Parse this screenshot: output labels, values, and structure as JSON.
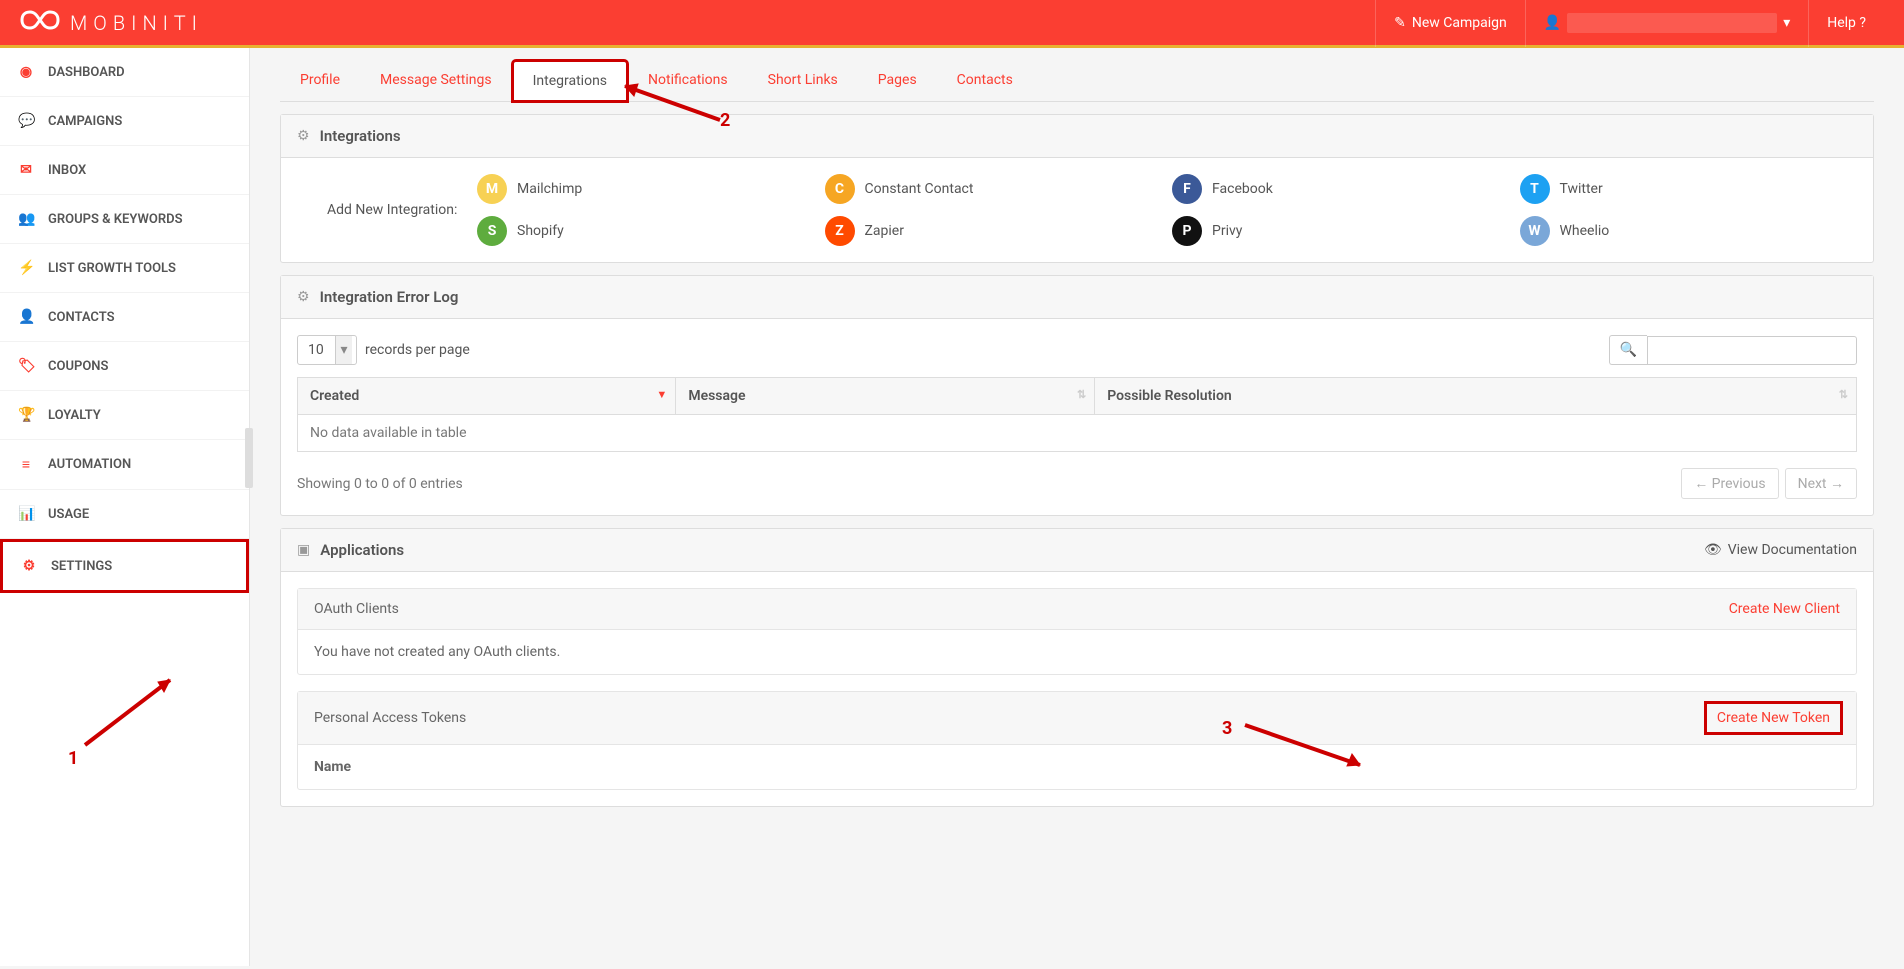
{
  "brand": "MOBINITI",
  "header": {
    "new_campaign": "New Campaign",
    "help": "Help ?"
  },
  "sidebar": {
    "items": [
      {
        "icon": "◉",
        "label": "DASHBOARD"
      },
      {
        "icon": "💬",
        "label": "CAMPAIGNS"
      },
      {
        "icon": "✉",
        "label": "INBOX"
      },
      {
        "icon": "👥",
        "label": "GROUPS & KEYWORDS"
      },
      {
        "icon": "⚡",
        "label": "LIST GROWTH TOOLS"
      },
      {
        "icon": "👤",
        "label": "CONTACTS"
      },
      {
        "icon": "🏷",
        "label": "COUPONS"
      },
      {
        "icon": "🏆",
        "label": "LOYALTY"
      },
      {
        "icon": "≡",
        "label": "AUTOMATION"
      },
      {
        "icon": "📊",
        "label": "USAGE"
      },
      {
        "icon": "⚙",
        "label": "SETTINGS"
      }
    ]
  },
  "tabs": [
    "Profile",
    "Message Settings",
    "Integrations",
    "Notifications",
    "Short Links",
    "Pages",
    "Contacts"
  ],
  "active_tab": "Integrations",
  "integrations_panel": {
    "title": "Integrations",
    "add_label": "Add New Integration:",
    "providers": [
      {
        "name": "Mailchimp",
        "color": "#f7d154"
      },
      {
        "name": "Constant Contact",
        "color": "#f6a623"
      },
      {
        "name": "Facebook",
        "color": "#3b5998"
      },
      {
        "name": "Twitter",
        "color": "#1da1f2"
      },
      {
        "name": "Shopify",
        "color": "#5eac3e"
      },
      {
        "name": "Zapier",
        "color": "#ff4a00"
      },
      {
        "name": "Privy",
        "color": "#111"
      },
      {
        "name": "Wheelio",
        "color": "#7aa7d8"
      }
    ]
  },
  "error_log": {
    "title": "Integration Error Log",
    "records_value": "10",
    "records_label": "records per page",
    "columns": [
      "Created",
      "Message",
      "Possible Resolution"
    ],
    "empty": "No data available in table",
    "showing": "Showing 0 to 0 of 0 entries",
    "prev": "← Previous",
    "next": "Next →"
  },
  "applications": {
    "title": "Applications",
    "view_doc": "View Documentation",
    "oauth": {
      "title": "OAuth Clients",
      "create": "Create New Client",
      "empty": "You have not created any OAuth clients."
    },
    "tokens": {
      "title": "Personal Access Tokens",
      "create": "Create New Token",
      "name_col": "Name"
    }
  },
  "annotations": {
    "n1": "1",
    "n2": "2",
    "n3": "3"
  }
}
